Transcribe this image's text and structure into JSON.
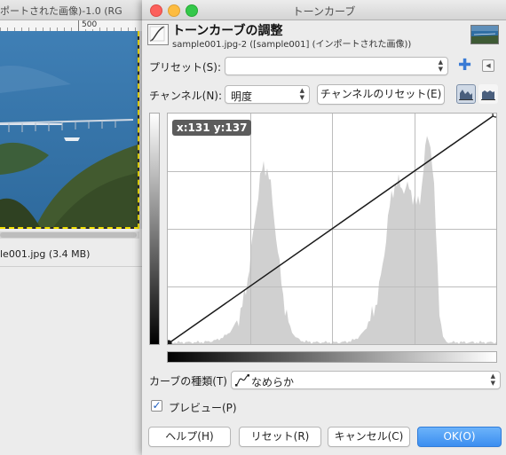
{
  "background_window": {
    "title": "ポートされた画像)-1.0 (RG",
    "ruler_label": "500",
    "status_text": "le001.jpg (3.4 MB)"
  },
  "dialog": {
    "window_title": "トーンカーブ",
    "heading": "トーンカーブの調整",
    "subtitle": "sample001.jpg-2 ([sample001] (インポートされた画像))",
    "icon": "curves-icon",
    "preset": {
      "label": "プリセット(S):",
      "value": "",
      "add_icon": "plus-icon",
      "menu_icon": "triangle-left-icon"
    },
    "channel": {
      "label": "チャンネル(N):",
      "value": "明度",
      "reset_label": "チャンネルのリセット(E)",
      "linear_icon": "linear-histogram-icon",
      "log_icon": "log-histogram-icon"
    },
    "curve": {
      "coords_label": "x:131 y:137",
      "points": [
        [
          0,
          0
        ],
        [
          255,
          255
        ]
      ],
      "histogram_scale": "linear"
    },
    "curve_type": {
      "label": "カーブの種類(T)",
      "value": "なめらか",
      "icon": "smooth-curve-icon"
    },
    "preview": {
      "label": "プレビュー(P)",
      "checked": true
    },
    "buttons": {
      "help": "ヘルプ(H)",
      "reset": "リセット(R)",
      "cancel": "キャンセル(C)",
      "ok": "OK(O)"
    },
    "colors": {
      "ok_button": "#3b8ef0",
      "accent": "#3a7bd5",
      "histogram": "#d0d0d0"
    }
  }
}
